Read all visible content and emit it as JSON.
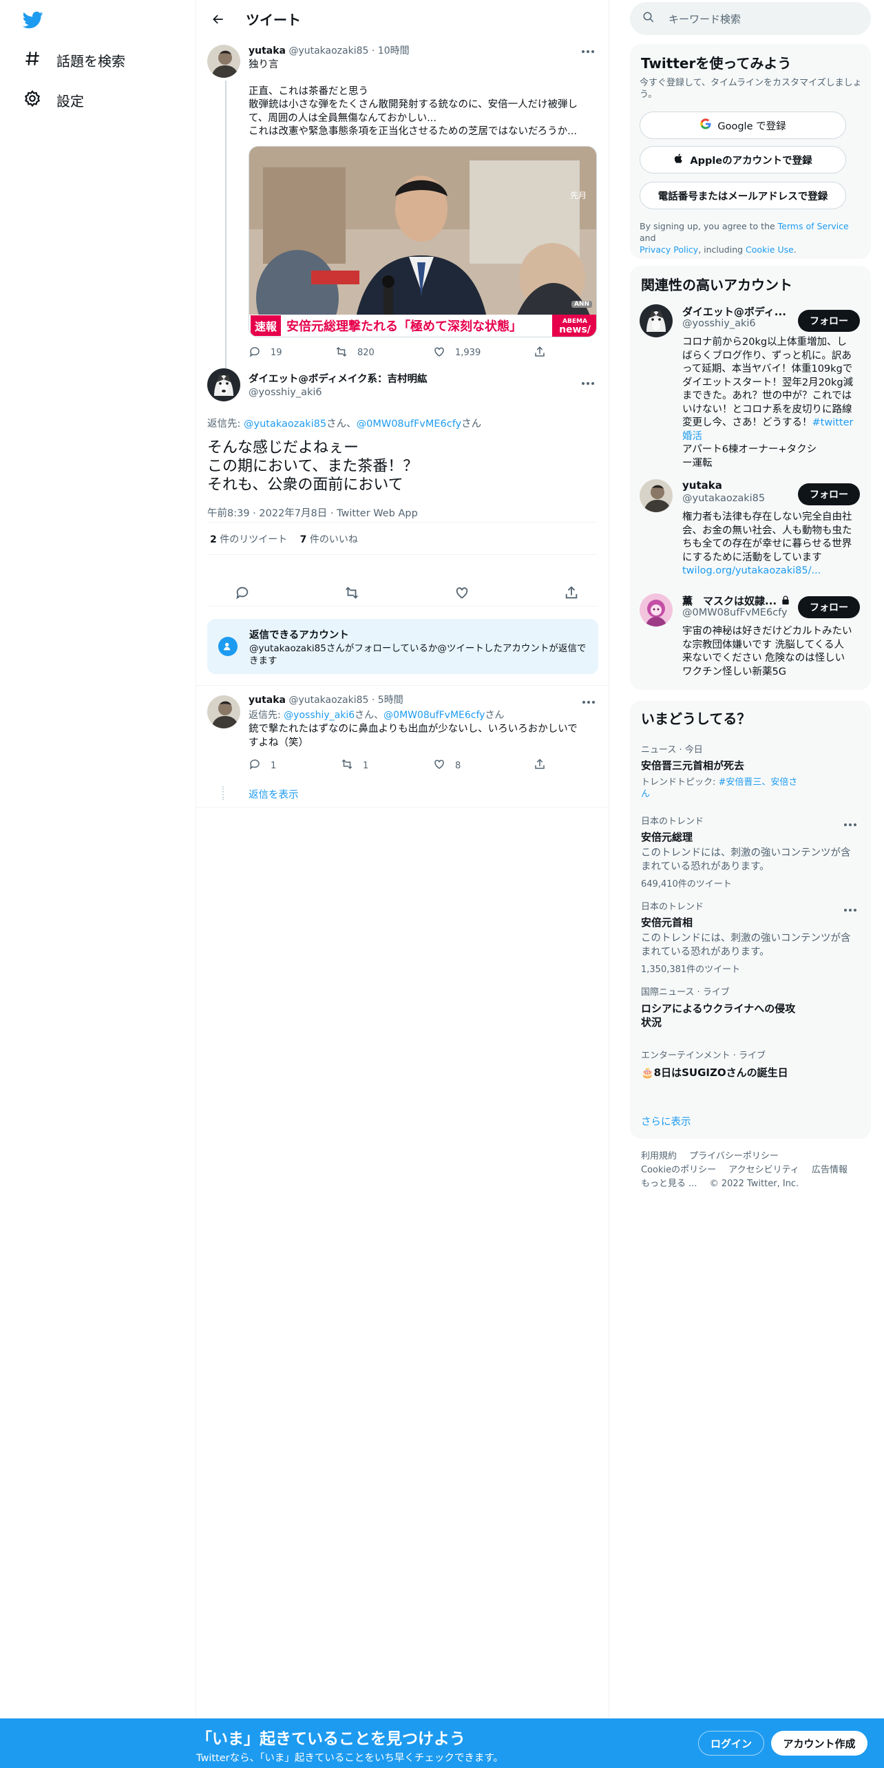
{
  "nav": {
    "explore_label": "話題を検索",
    "settings_label": "設定"
  },
  "header": {
    "title": "ツイート"
  },
  "parent_tweet": {
    "name": "yutaka",
    "handle": "@yutakaozaki85",
    "time": "· 10時間",
    "text_lines": [
      "独り言",
      "",
      "正直、これは茶番だと思う",
      "散弾銃は小さな弾をたくさん散開発射する銃なのに、安倍一人だけ被弾し",
      "て、周囲の人は全員無傷なんておかしい...",
      "これは改憲や緊急事態条項を正当化させるための芝居ではないだろうか..."
    ],
    "image_badge": "先月",
    "image_corner": "ANN",
    "image_caption_tag": "速報",
    "image_caption": "安倍元総理撃たれる「極めて深刻な状態」",
    "image_logo_top": "ABEMA",
    "image_logo_bottom": "news/",
    "reply_count": "19",
    "retweet_count": "820",
    "like_count": "1,939"
  },
  "main_tweet": {
    "name": "ダイエット@ボディメイク系：吉村明紘",
    "handle": "@yosshiy_aki6",
    "reply_prefix": "返信先: ",
    "reply_to_1": "@yutakaozaki85",
    "reply_san_1": "さん、",
    "reply_to_2": "@0MW08ufFvME6cfy",
    "reply_san_2": "さん",
    "text_lines": [
      "そんな感じだよねぇー",
      "この期において、また茶番！？",
      "それも、公衆の面前において"
    ],
    "timestamp": "午前8:39 · 2022年7月8日 · Twitter Web App",
    "retweets_num": "2",
    "retweets_label": " 件のリツイート",
    "likes_num": "7",
    "likes_label": " 件のいいね"
  },
  "reply_notice": {
    "title": "返信できるアカウント",
    "text": "@yutakaozaki85さんがフォローしているか@ツイートしたアカウントが返信できます"
  },
  "reply_tweet": {
    "name": "yutaka",
    "handle": "@yutakaozaki85",
    "time": "· 5時間",
    "reply_prefix": "返信先: ",
    "reply_to_1": "@yosshiy_aki6",
    "reply_san_1": "さん、",
    "reply_to_2": "@0MW08ufFvME6cfy",
    "reply_san_2": "さん",
    "text_lines": [
      "銃で撃たれたはずなのに鼻血よりも出血が少ないし、いろいろおかしいで",
      "すよね（笑）"
    ],
    "reply_count": "1",
    "retweet_count": "1",
    "like_count": "8",
    "show_replies": "返信を表示"
  },
  "search": {
    "placeholder": "キーワード検索"
  },
  "signup": {
    "title": "Twitterを使ってみよう",
    "subtitle_lines": [
      "今すぐ登録して、タイムラインをカスタマイズしましょ",
      "う。"
    ],
    "google_label": "Google で登録",
    "apple_label": "Appleのアカウントで登録",
    "phone_label": "電話番号またはメールアドレスで登録",
    "terms_1": "By signing up, you agree to the ",
    "terms_link_1": "Terms of Service",
    "terms_2": " and",
    "terms_link_2": "Privacy Policy",
    "terms_3": ", including ",
    "terms_link_3": "Cookie Use",
    "terms_4": "."
  },
  "related": {
    "title": "関連性の高いアカウント",
    "follow_label": "フォロー",
    "accounts": [
      {
        "name": "ダイエット@ボディ...",
        "handle": "@yosshiy_aki6",
        "bio_lines": [
          "コロナ前から20kg以上体重増加、し",
          "ばらくブログ作り、ずっと机に。訳あ",
          "って延期、本当ヤバイ！体重109kgで",
          "ダイエットスタート！翌年2月20kg減",
          "まできた。あれ？世の中が？これでは",
          "いけない！とコロナ系を皮切りに路線",
          "変更し今、さあ！どうする！"
        ],
        "bio_link": "#twitter婚活",
        "bio_tail": "アパート6棟オーナー+タクシ",
        "bio_last": "ー運転"
      },
      {
        "name": "yutaka",
        "handle": "@yutakaozaki85",
        "bio_lines": [
          "権力者も法律も存在しない完全自由社",
          "会、お金の無い社会、人も動物も虫た",
          "ちも全ての存在が幸せに暮らせる世界",
          "にするために活動をしています"
        ],
        "bio_link": "twilog.org/yutakaozaki85/..."
      },
      {
        "name": "薫　マスクは奴隷...",
        "handle": "@0MW08ufFvME6cfy",
        "bio_lines": [
          "宇宙の神秘は好きだけどカルトみたい",
          "な宗教団体嫌いです 洗脳してくる人",
          "来ないでください 危険なのは怪しい",
          "ワクチン怪しい新薬5G"
        ]
      }
    ]
  },
  "trends": {
    "title": "いまどうしてる？",
    "items": [
      {
        "context": "ニュース · 今日",
        "name": "安倍晋三元首相が死去",
        "topic_prefix": "トレンドトピック: ",
        "topic_links": "#安倍晋三、安倍さ",
        "topic_links2": "ん"
      },
      {
        "context": "日本のトレンド",
        "name": "安倍元総理",
        "desc_lines": [
          "このトレンドには、刺激の強いコンテンツが含",
          "まれている恐れがあります。"
        ],
        "count": "649,410件のツイート"
      },
      {
        "context": "日本のトレンド",
        "name": "安倍元首相",
        "desc_lines": [
          "このトレンドには、刺激の強いコンテンツが含",
          "まれている恐れがあります。"
        ],
        "count": "1,350,381件のツイート"
      },
      {
        "context": "国際ニュース · ライブ",
        "name_lines": [
          "ロシアによるウクライナへの侵攻",
          "状況"
        ]
      },
      {
        "context": "エンターテインメント · ライブ",
        "name": "🎂8日はSUGIZOさんの誕生日"
      }
    ],
    "show_more": "さらに表示"
  },
  "footer": {
    "terms": "利用規約",
    "privacy": "プライバシーポリシー",
    "cookie": "Cookieのポリシー",
    "accessibility": "アクセシビリティ",
    "ads": "広告情報",
    "more": "もっと見る ...",
    "copyright": "© 2022 Twitter, Inc."
  },
  "bottom_bar": {
    "title": "「いま」起きていることを見つけよう",
    "subtitle": "Twitterなら、「いま」起きていることをいち早くチェックできます。",
    "login": "ログイン",
    "signup": "アカウント作成"
  },
  "colors": {
    "accent": "#1d9bf0",
    "text": "#0f1419",
    "muted": "#536471"
  }
}
